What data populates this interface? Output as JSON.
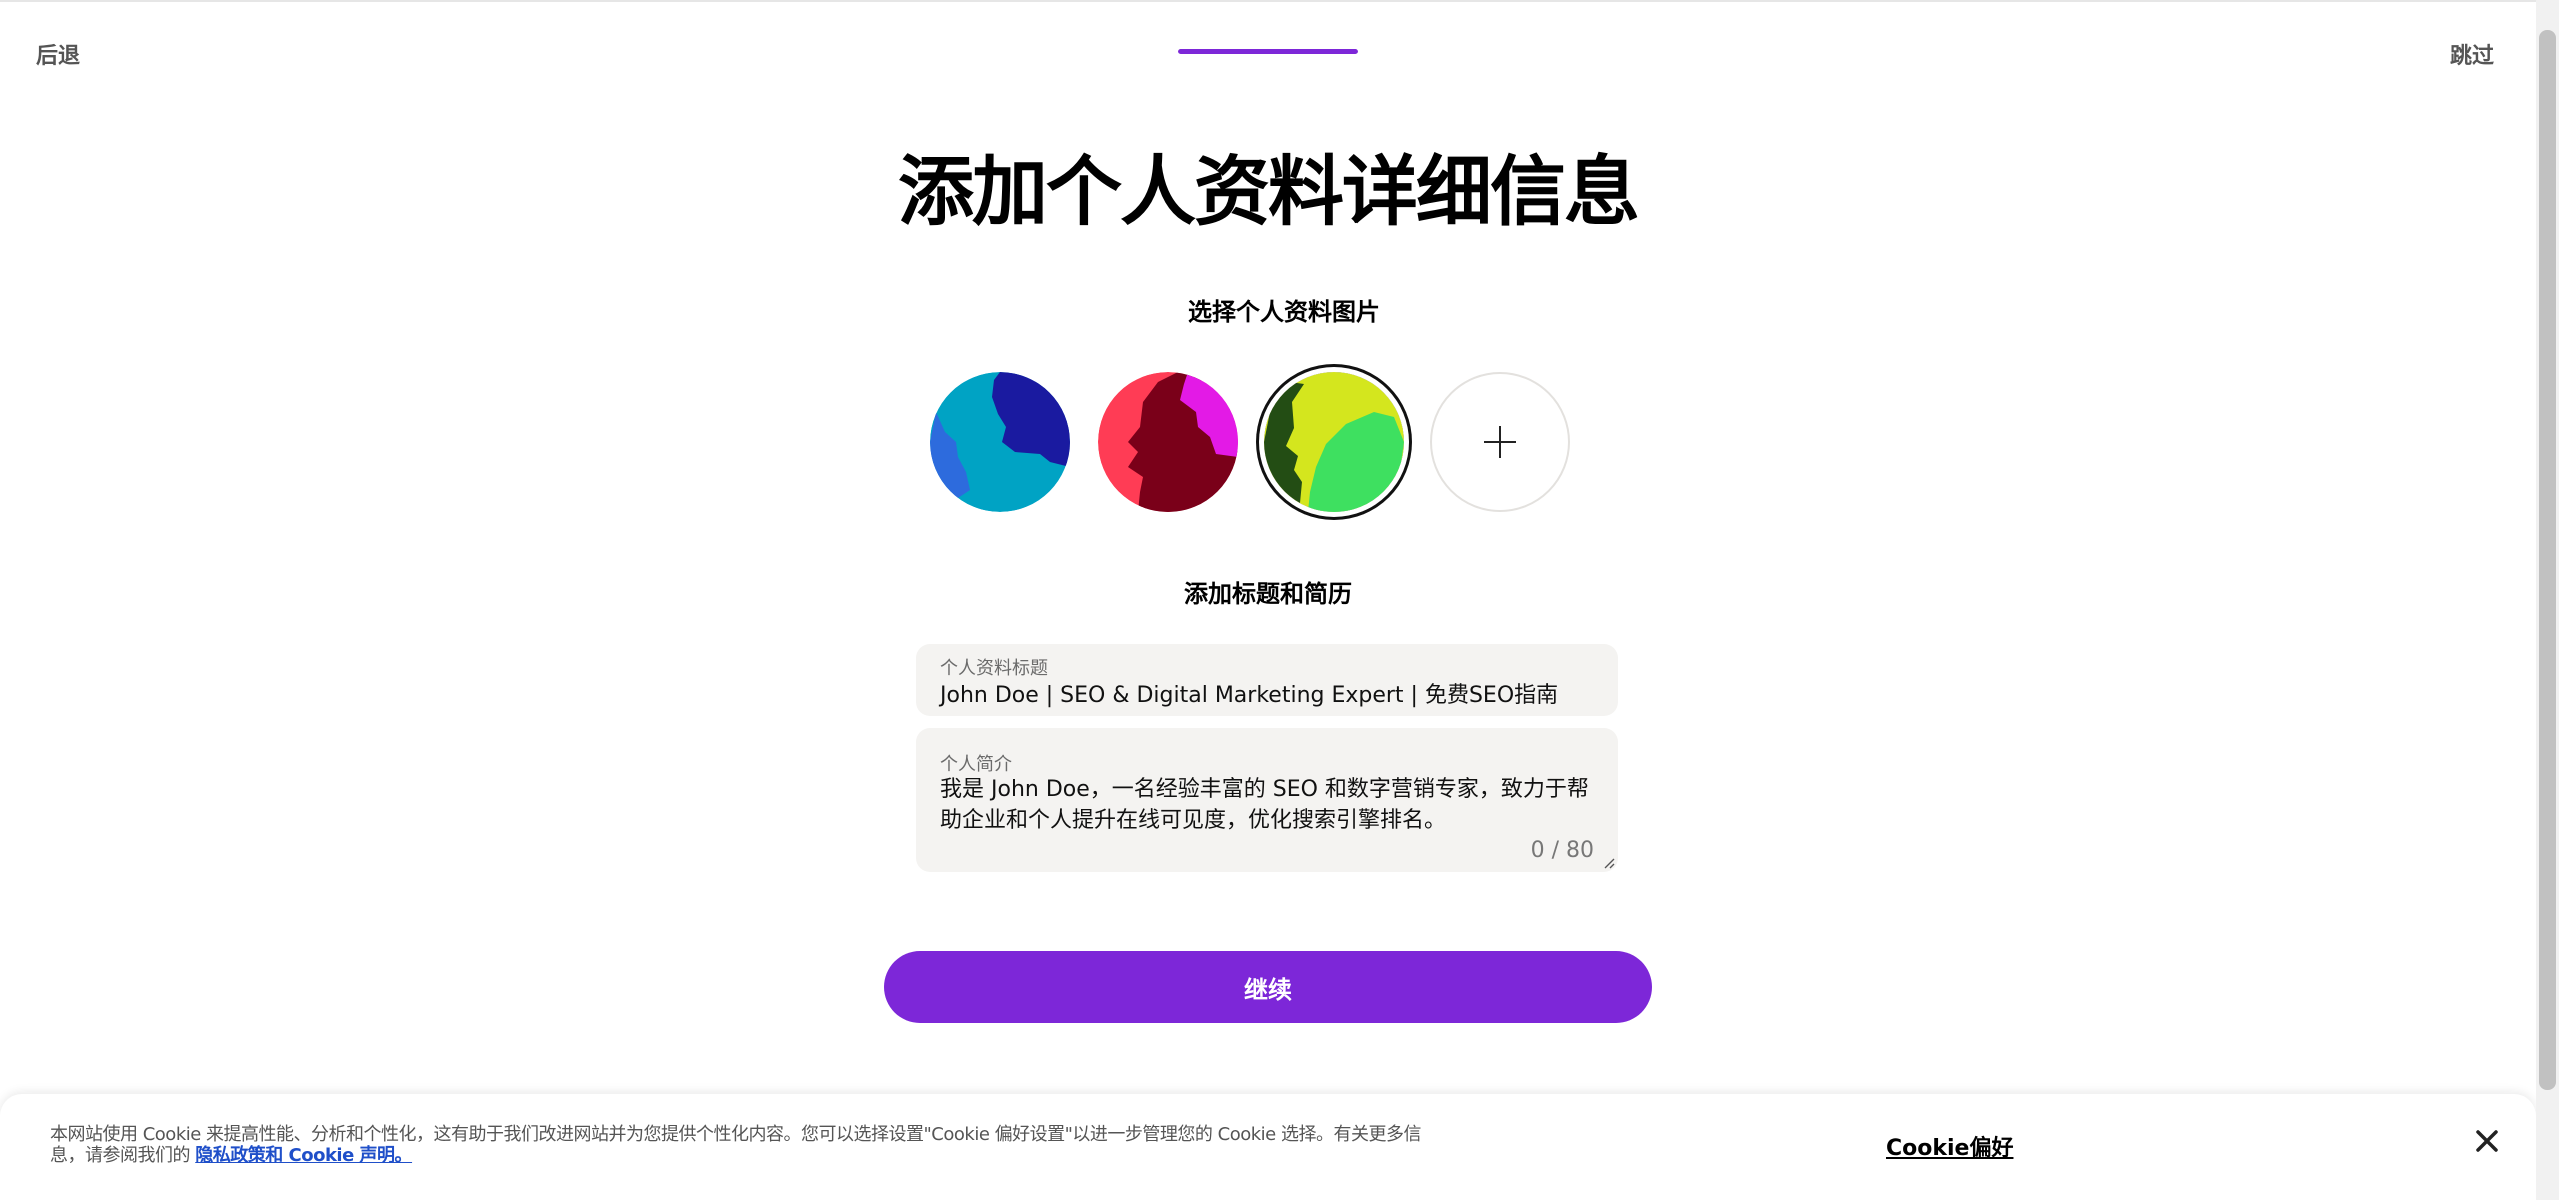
{
  "header": {
    "back_label": "后退",
    "skip_label": "跳过",
    "progress_fraction": 1.0
  },
  "main": {
    "title": "添加个人资料详细信息",
    "avatar_section_label": "选择个人资料图片",
    "avatars": [
      {
        "name": "avatar-option-1",
        "selected": false,
        "colors": [
          "#00a3c4",
          "#1a1aa0",
          "#2d6bdd"
        ]
      },
      {
        "name": "avatar-option-2",
        "selected": false,
        "colors": [
          "#ff3c55",
          "#7a0019",
          "#e31ae6"
        ]
      },
      {
        "name": "avatar-option-3",
        "selected": true,
        "colors": [
          "#d4e61e",
          "#234d14",
          "#3ee060"
        ]
      }
    ],
    "add_avatar_icon": "plus-icon",
    "details_section_label": "添加标题和简历",
    "title_field": {
      "label": "个人资料标题",
      "value": "John Doe | SEO & Digital Marketing Expert | 免费SEO指南"
    },
    "bio_field": {
      "label": "个人简介",
      "value": "我是 John Doe，一名经验丰富的 SEO 和数字营销专家，致力于帮助企业和个人提升在线可见度，优化搜索引擎排名。",
      "counter": "0 / 80"
    },
    "continue_label": "继续"
  },
  "cookie_banner": {
    "text": "本网站使用 Cookie 来提高性能、分析和个性化，这有助于我们改进网站并为您提供个性化内容。您可以选择设置\"Cookie 偏好设置\"以进一步管理您的 Cookie 选择。有关更多信息，请参阅我们的",
    "link_label": "隐私政策和 Cookie 声明。",
    "preferences_label": "Cookie偏好",
    "close_icon": "close-icon"
  },
  "colors": {
    "accent": "#7d27d8",
    "field_bg": "#f4f3f1",
    "link": "#1f4fc9"
  }
}
